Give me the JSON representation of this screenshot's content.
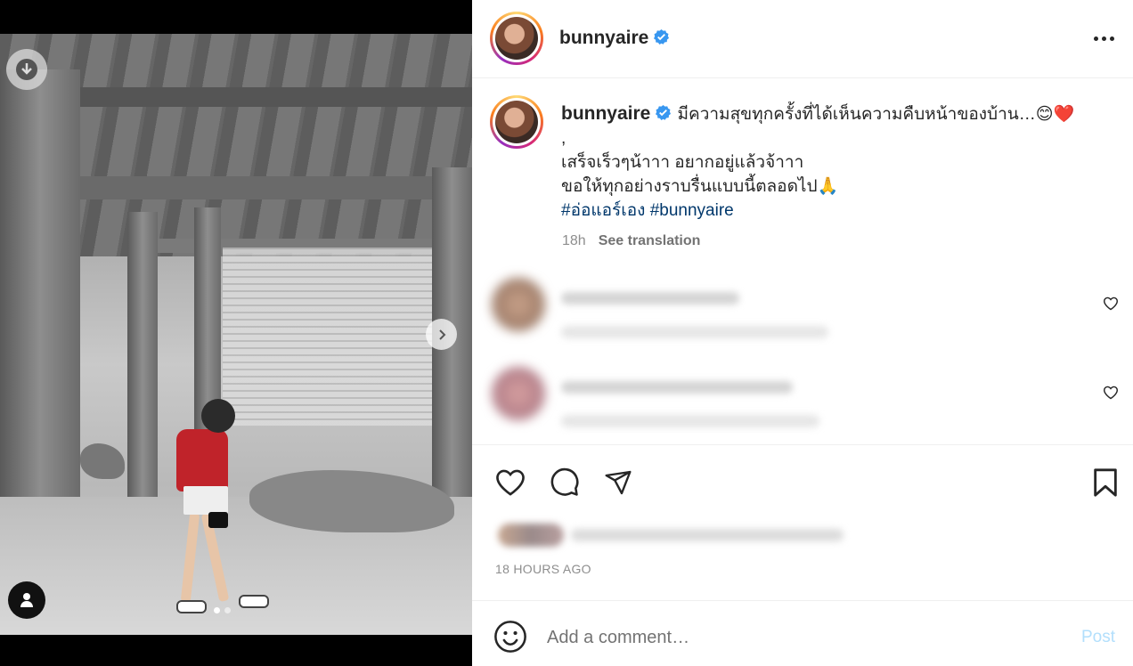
{
  "post": {
    "author": "bunnyaire",
    "verified": true,
    "caption_line1": "มีความสุขทุกครั้งที่ได้เห็นความคืบหน้าของบ้าน…😊❤️",
    "caption_line2": ",",
    "caption_line3": "เสร็จเร็วๆน้าาา อยากอยู่แล้วจ้าาา",
    "caption_line4": "ขอให้ทุกอย่างราบรื่นแบบนี้ตลอดไป🙏",
    "hashtag1": "#อ่อแอร์เอง",
    "hashtag2": "#bunnyaire",
    "age": "18h",
    "see_translation": "See translation",
    "timestamp": "18 HOURS AGO"
  },
  "media": {
    "carousel_dots": 2,
    "active_dot": 0
  },
  "comment_box": {
    "placeholder": "Add a comment…",
    "post_label": "Post"
  },
  "colors": {
    "verified": "#3897f0",
    "hashtag": "#00376b",
    "post_disabled": "#b2dffc"
  },
  "icons": [
    "download-icon",
    "chevron-right-icon",
    "user-tag-icon",
    "more-icon",
    "verified-icon",
    "heart-icon",
    "comment-icon",
    "share-icon",
    "bookmark-icon",
    "emoji-icon"
  ]
}
